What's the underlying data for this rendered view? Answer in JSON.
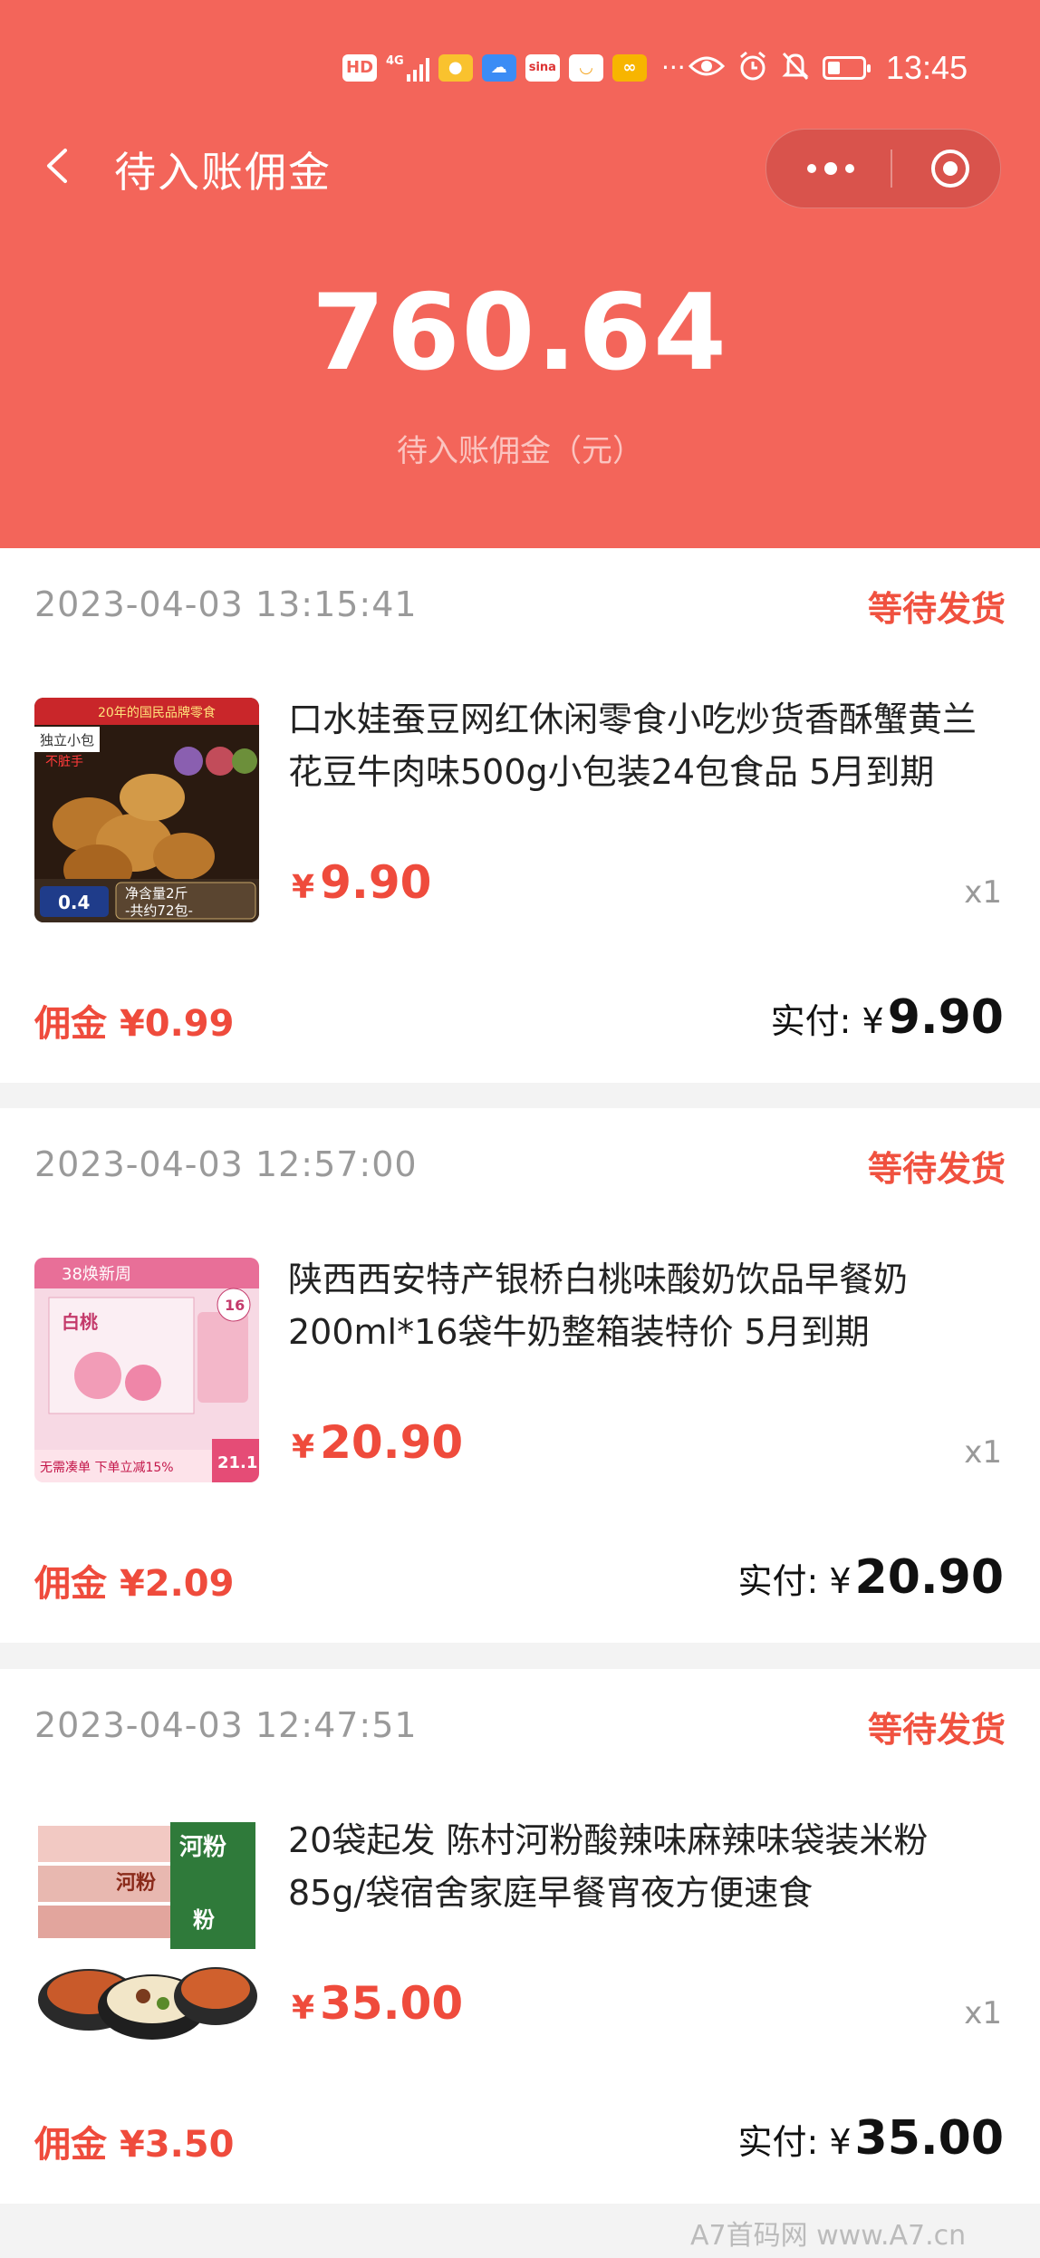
{
  "statusbar": {
    "left_badges": [
      "HD",
      "4G",
      "",
      "",
      "",
      "",
      "",
      ""
    ],
    "time": "13:45",
    "more": "···",
    "battery_level": 0.35
  },
  "nav": {
    "title": "待入账佣金"
  },
  "summary": {
    "amount": "760.64",
    "label": "待入账佣金（元）"
  },
  "orders": [
    {
      "time": "2023-04-03 13:15:41",
      "status": "等待发货",
      "name": "口水娃蚕豆网红休闲零食小吃炒货香酥蟹黄兰花豆牛肉味500g小包装24包食品 5月到期",
      "price_symbol": "¥",
      "price": "9.90",
      "qty": "x1",
      "commission_label": "佣金",
      "commission": "¥0.99",
      "paid_label": "实付: ¥",
      "paid": "9.90",
      "thumb_text": [
        "20年的国民品牌零食",
        "独立小包",
        "不脏手",
        "净含量2斤",
        "-共约72包-",
        "0.4"
      ]
    },
    {
      "time": "2023-04-03 12:57:00",
      "status": "等待发货",
      "name": "陕西西安特产银桥白桃味酸奶饮品早餐奶200ml*16袋牛奶整箱装特价 5月到期",
      "price_symbol": "¥",
      "price": "20.90",
      "qty": "x1",
      "commission_label": "佣金",
      "commission": "¥2.09",
      "paid_label": "实付: ¥",
      "paid": "20.90",
      "thumb_text": [
        "38焕新周",
        "白桃",
        "16",
        "无需凑单 下单立减15%",
        "21.1"
      ]
    },
    {
      "time": "2023-04-03 12:47:51",
      "status": "等待发货",
      "name": "20袋起发 陈村河粉酸辣味麻辣味袋装米粉85g/袋宿舍家庭早餐宵夜方便速食",
      "price_symbol": "¥",
      "price": "35.00",
      "qty": "x1",
      "commission_label": "佣金",
      "commission": "¥3.50",
      "paid_label": "实付: ¥",
      "paid": "35.00",
      "thumb_text": [
        "河粉",
        "河粉",
        "粉"
      ]
    }
  ],
  "watermark": "A7首码网 www.A7.cn"
}
